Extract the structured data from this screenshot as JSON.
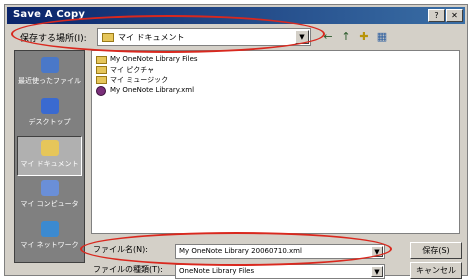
{
  "window": {
    "title": "Save A Copy"
  },
  "toolbar": {
    "lookin_label": "保存する場所(I):",
    "lookin_value": "マイ ドキュメント",
    "icons": [
      "back-icon",
      "up-folder-icon",
      "new-folder-icon",
      "views-icon"
    ]
  },
  "places": [
    {
      "label": "最近使ったファイル",
      "icon": "history-icon"
    },
    {
      "label": "デスクトップ",
      "icon": "desktop-icon"
    },
    {
      "label": "マイ ドキュメント",
      "icon": "my-documents-icon"
    },
    {
      "label": "マイ コンピュータ",
      "icon": "my-computer-icon"
    },
    {
      "label": "マイ ネットワーク",
      "icon": "my-network-icon"
    }
  ],
  "files": [
    {
      "name": "My OneNote Library Files",
      "icon": "folder-icon"
    },
    {
      "name": "マイ ピクチャ",
      "icon": "folder-icon"
    },
    {
      "name": "マイ ミュージック",
      "icon": "folder-icon"
    },
    {
      "name": "My OneNote Library.xml",
      "icon": "onenote-file-icon"
    }
  ],
  "filename": {
    "label": "ファイル名(N):",
    "value": "My OneNote Library 20060710.xml"
  },
  "filetype": {
    "label": "ファイルの種類(T):",
    "value": "OneNote Library Files"
  },
  "buttons": {
    "save": "保存(S)",
    "cancel": "キャンセル"
  },
  "colors": {
    "highlight": "#d9281e",
    "titlebar": "#0a246a"
  }
}
